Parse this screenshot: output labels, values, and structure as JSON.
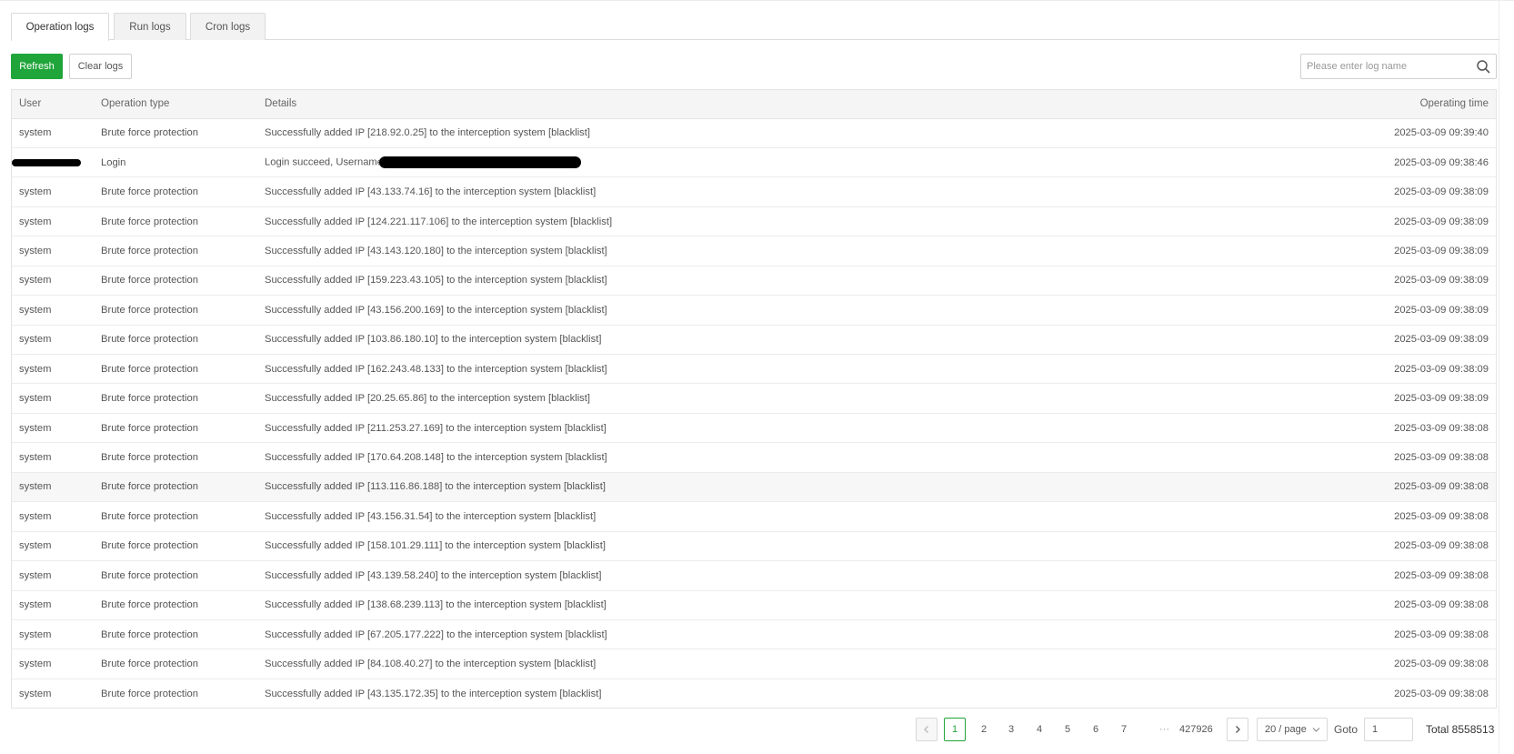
{
  "tabs": [
    {
      "label": "Operation logs",
      "active": true
    },
    {
      "label": "Run logs",
      "active": false
    },
    {
      "label": "Cron logs",
      "active": false
    }
  ],
  "toolbar": {
    "refresh_label": "Refresh",
    "clear_label": "Clear logs",
    "search_placeholder": "Please enter log name",
    "search_value": ""
  },
  "table": {
    "headers": {
      "user": "User",
      "type": "Operation type",
      "details": "Details",
      "time": "Operating time"
    },
    "rows": [
      {
        "user": "system",
        "type": "Brute force protection",
        "details": "Successfully added IP [218.92.0.25] to the interception system [blacklist]",
        "time": "2025-03-09 09:39:40"
      },
      {
        "user": "",
        "type": "Login",
        "details": "Login succeed, Username",
        "time": "2025-03-09 09:38:46",
        "redacted": true
      },
      {
        "user": "system",
        "type": "Brute force protection",
        "details": "Successfully added IP [43.133.74.16] to the interception system [blacklist]",
        "time": "2025-03-09 09:38:09"
      },
      {
        "user": "system",
        "type": "Brute force protection",
        "details": "Successfully added IP [124.221.117.106] to the interception system [blacklist]",
        "time": "2025-03-09 09:38:09"
      },
      {
        "user": "system",
        "type": "Brute force protection",
        "details": "Successfully added IP [43.143.120.180] to the interception system [blacklist]",
        "time": "2025-03-09 09:38:09"
      },
      {
        "user": "system",
        "type": "Brute force protection",
        "details": "Successfully added IP [159.223.43.105] to the interception system [blacklist]",
        "time": "2025-03-09 09:38:09"
      },
      {
        "user": "system",
        "type": "Brute force protection",
        "details": "Successfully added IP [43.156.200.169] to the interception system [blacklist]",
        "time": "2025-03-09 09:38:09"
      },
      {
        "user": "system",
        "type": "Brute force protection",
        "details": "Successfully added IP [103.86.180.10] to the interception system [blacklist]",
        "time": "2025-03-09 09:38:09"
      },
      {
        "user": "system",
        "type": "Brute force protection",
        "details": "Successfully added IP [162.243.48.133] to the interception system [blacklist]",
        "time": "2025-03-09 09:38:09"
      },
      {
        "user": "system",
        "type": "Brute force protection",
        "details": "Successfully added IP [20.25.65.86] to the interception system [blacklist]",
        "time": "2025-03-09 09:38:09"
      },
      {
        "user": "system",
        "type": "Brute force protection",
        "details": "Successfully added IP [211.253.27.169] to the interception system [blacklist]",
        "time": "2025-03-09 09:38:08"
      },
      {
        "user": "system",
        "type": "Brute force protection",
        "details": "Successfully added IP [170.64.208.148] to the interception system [blacklist]",
        "time": "2025-03-09 09:38:08"
      },
      {
        "user": "system",
        "type": "Brute force protection",
        "details": "Successfully added IP [113.116.86.188] to the interception system [blacklist]",
        "time": "2025-03-09 09:38:08",
        "highlighted": true
      },
      {
        "user": "system",
        "type": "Brute force protection",
        "details": "Successfully added IP [43.156.31.54] to the interception system [blacklist]",
        "time": "2025-03-09 09:38:08"
      },
      {
        "user": "system",
        "type": "Brute force protection",
        "details": "Successfully added IP [158.101.29.111] to the interception system [blacklist]",
        "time": "2025-03-09 09:38:08"
      },
      {
        "user": "system",
        "type": "Brute force protection",
        "details": "Successfully added IP [43.139.58.240] to the interception system [blacklist]",
        "time": "2025-03-09 09:38:08"
      },
      {
        "user": "system",
        "type": "Brute force protection",
        "details": "Successfully added IP [138.68.239.113] to the interception system [blacklist]",
        "time": "2025-03-09 09:38:08"
      },
      {
        "user": "system",
        "type": "Brute force protection",
        "details": "Successfully added IP [67.205.177.222] to the interception system [blacklist]",
        "time": "2025-03-09 09:38:08"
      },
      {
        "user": "system",
        "type": "Brute force protection",
        "details": "Successfully added IP [84.108.40.27] to the interception system [blacklist]",
        "time": "2025-03-09 09:38:08"
      },
      {
        "user": "system",
        "type": "Brute force protection",
        "details": "Successfully added IP [43.135.172.35] to the interception system [blacklist]",
        "time": "2025-03-09 09:38:08"
      }
    ]
  },
  "pagination": {
    "pages": [
      "1",
      "2",
      "3",
      "4",
      "5",
      "6",
      "7"
    ],
    "active_page": "1",
    "ellipsis": "···",
    "last_page": "427926",
    "page_size": "20 / page",
    "goto_label": "Goto",
    "goto_value": "1",
    "total": "Total 8558513"
  },
  "colors": {
    "accent": "#20a53a",
    "header_bg": "#f5f5f5",
    "border": "#e4e4e4"
  },
  "icons": {
    "search": "search-icon",
    "prev": "chevron-left-icon",
    "next": "chevron-right-icon",
    "dropdown": "chevron-down-icon"
  }
}
